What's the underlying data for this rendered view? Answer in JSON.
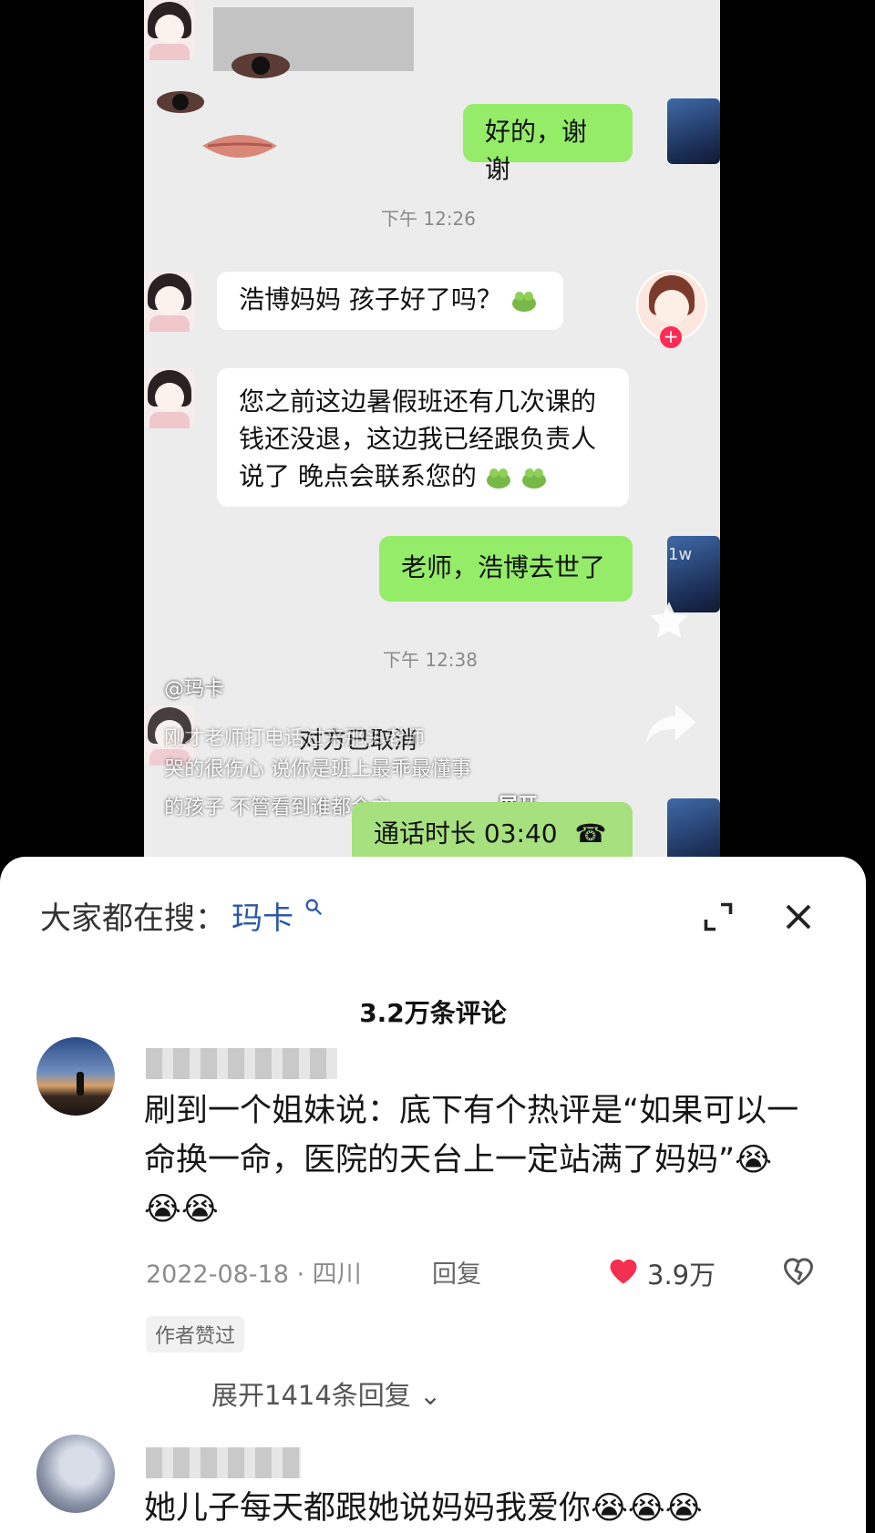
{
  "chat": {
    "top_reply": "好的，谢谢",
    "time1": "下午 12:26",
    "msg1": "浩博妈妈 孩子好了吗？",
    "msg2": "您之前这边暑假班还有几次课的钱还没退，这边我已经跟负责人说了 晚点会联系您的",
    "reply2": "老师，浩博去世了",
    "time2": "下午 12:38",
    "call_cancel": "对方已取消",
    "call_duration": "通话时长 03:40"
  },
  "video_overlay": {
    "author": "@玛卡",
    "caption_line1": "刚才老师打电话过来那头老师",
    "caption_line2": "哭的很伤心 说你是班上最乖最懂事",
    "caption_line3": "的孩子 不管看到谁都会主",
    "expand": "展开",
    "likes_badge": "1w"
  },
  "panel": {
    "search_prefix": "大家都在搜：",
    "search_keyword": "玛卡",
    "comment_count": "3.2万条评论"
  },
  "comments": [
    {
      "text": "刷到一个姐妹说：底下有个热评是“如果可以一命换一命，医院的天台上一定站满了妈妈”😭😭😭",
      "date_location": "2022-08-18 · 四川",
      "reply_label": "回复",
      "likes": "3.9万",
      "author_liked": "作者赞过",
      "expand_replies": "展开1414条回复"
    },
    {
      "text": "她儿子每天都跟她说妈妈我爱你😭😭😭"
    }
  ]
}
